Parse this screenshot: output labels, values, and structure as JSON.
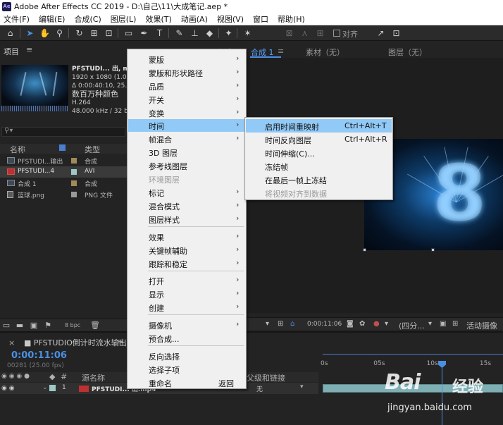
{
  "window": {
    "app_icon": "Ae",
    "title": "Adobe After Effects CC 2019 - D:\\自己\\11\\大成笔记.aep *"
  },
  "menubar": {
    "items": [
      "文件(F)",
      "编辑(E)",
      "合成(C)",
      "图层(L)",
      "效果(T)",
      "动画(A)",
      "视图(V)",
      "窗口",
      "帮助(H)"
    ]
  },
  "toolbar": {
    "align_label": "对齐"
  },
  "project_panel": {
    "title": "项目",
    "menu_glyph": "≡",
    "footage_info": [
      "PFSTUDI... 出, mp4",
      "1920 x 1080 (1.00)",
      "Δ 0:00:40:10, 25.00",
      "数百万种颜色",
      "H.264",
      "48.000 kHz / 32 bit U"
    ],
    "columns": {
      "name": "名称",
      "type": "类型"
    },
    "rows": [
      {
        "name": "PFSTUDI...输出",
        "type": "合成",
        "label_color": "#a08a5a",
        "kind": "comp"
      },
      {
        "name": "PFSTUDI...4",
        "type": "AVI",
        "label_color": "#9fc8c8",
        "kind": "avi"
      },
      {
        "name": "合成 1",
        "type": "合成",
        "label_color": "#a08a5a",
        "kind": "comp"
      },
      {
        "name": "篮球.png",
        "type": "PNG 文件",
        "label_color": "#9a9a9a",
        "kind": "png"
      }
    ],
    "bpc": "8 bpc"
  },
  "composition": {
    "tabs": [
      "合成 合成 1",
      "素材（无）",
      "图层（无）"
    ],
    "active_tab_label": "合成 1",
    "viewer_time": "0:00:11:06",
    "resolution": "(四分...",
    "camera": "活动摄像机"
  },
  "timeline": {
    "tab_title": "PFSTUDIO倒计时流水输出",
    "current_time": "0:00:11:06",
    "frame_info": "00281 (25.00 fps)",
    "col_hash": "#",
    "col_source": "源名称",
    "col_parent": "父级和链接",
    "layer": {
      "index": "1",
      "name": "PFSTUDI... 出.mp4",
      "parent": "无"
    },
    "ticks": [
      "0s",
      "05s",
      "10s",
      "15s"
    ],
    "playhead_seconds": 11.24,
    "range_seconds": [
      0,
      17
    ]
  },
  "context_menu": {
    "items": [
      {
        "label": "蒙版",
        "submenu": true
      },
      {
        "label": "蒙版和形状路径",
        "submenu": true
      },
      {
        "label": "品质",
        "submenu": true
      },
      {
        "label": "开关",
        "submenu": true
      },
      {
        "label": "变换",
        "submenu": true
      },
      {
        "label": "时间",
        "submenu": true,
        "highlighted": true
      },
      {
        "label": "帧混合",
        "submenu": true
      },
      {
        "label": "3D 图层",
        "submenu": false
      },
      {
        "label": "参考线图层",
        "submenu": false
      },
      {
        "label": "环境图层",
        "submenu": false,
        "disabled": true
      },
      {
        "label": "标记",
        "submenu": true
      },
      {
        "label": "混合模式",
        "submenu": true
      },
      {
        "label": "图层样式",
        "submenu": true
      },
      {
        "label": "效果",
        "submenu": true
      },
      {
        "label": "关键帧辅助",
        "submenu": true
      },
      {
        "label": "跟踪和稳定",
        "submenu": true
      },
      {
        "label": "打开",
        "submenu": true
      },
      {
        "label": "显示",
        "submenu": true
      },
      {
        "label": "创建",
        "submenu": true
      },
      {
        "label": "摄像机",
        "submenu": true
      },
      {
        "label": "预合成...",
        "submenu": false
      },
      {
        "label": "反向选择",
        "submenu": false
      },
      {
        "label": "选择子项",
        "submenu": false
      },
      {
        "label": "重命名",
        "submenu": false,
        "shortcut": "返回"
      }
    ]
  },
  "submenu_time": {
    "items": [
      {
        "label": "启用时间重映射",
        "shortcut": "Ctrl+Alt+T",
        "highlighted": true
      },
      {
        "label": "时间反向图层",
        "shortcut": "Ctrl+Alt+R"
      },
      {
        "label": "时间伸缩(C)..."
      },
      {
        "label": "冻结帧"
      },
      {
        "label": "在最后一帧上冻结"
      },
      {
        "label": "将视频对齐到数据",
        "disabled": true
      }
    ]
  },
  "watermark": {
    "brand": "Bai",
    "brand_suffix": "经验",
    "url": "jingyan.baidu.com"
  }
}
